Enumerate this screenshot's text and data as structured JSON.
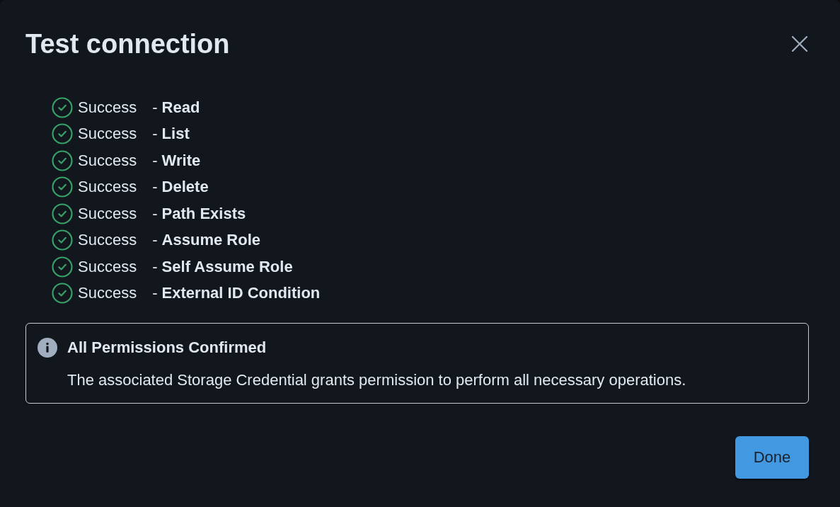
{
  "dialog": {
    "title": "Test connection"
  },
  "checks": [
    {
      "status": "Success",
      "label": "- **Read**",
      "passed": true
    },
    {
      "status": "Success",
      "label": "- **List**",
      "passed": true
    },
    {
      "status": "Success",
      "label": "- **Write**",
      "passed": true
    },
    {
      "status": "Success",
      "label": "- **Delete**",
      "passed": true
    },
    {
      "status": "Success",
      "label": "- **Path Exists**",
      "passed": true
    },
    {
      "status": "Success",
      "label": "- **Assume Role**",
      "passed": true
    },
    {
      "status": "Success",
      "label": "- **Self Assume Role**",
      "passed": true
    },
    {
      "status": "Success",
      "label": "- **External ID Condition**",
      "passed": true
    }
  ],
  "alert": {
    "kind": "info",
    "title": "All Permissions Confirmed",
    "message": "The associated Storage Credential grants permission to perform all necessary operations."
  },
  "buttons": [
    {
      "label": "Done",
      "kind": "primary"
    }
  ]
}
